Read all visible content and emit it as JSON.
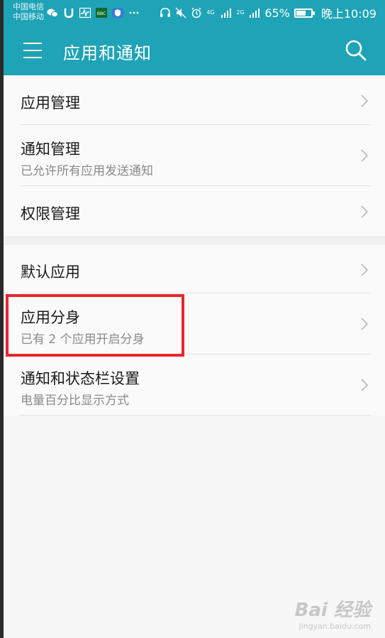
{
  "status_bar": {
    "carrier_1": "中国电信",
    "carrier_2": "中国移动",
    "network_1": "4G",
    "network_2": "2G",
    "battery_percent": "65%",
    "battery_level": 0.65,
    "time": "晚上10:09",
    "icons_left": [
      "wechat-icon",
      "shield-u-icon",
      "pulse-icon",
      "bbc-icon",
      "security-icon",
      "more-icon"
    ],
    "icons_right": [
      "headphone-icon",
      "mute-icon",
      "alarm-icon",
      "signal-icon",
      "battery-icon"
    ]
  },
  "app_bar": {
    "title": "应用和通知",
    "menu_icon": "menu-icon",
    "search_icon": "search-icon"
  },
  "groups": [
    {
      "items": [
        {
          "title": "应用管理",
          "subtitle": ""
        },
        {
          "title": "通知管理",
          "subtitle": "已允许所有应用发送通知"
        },
        {
          "title": "权限管理",
          "subtitle": ""
        }
      ]
    },
    {
      "items": [
        {
          "title": "默认应用",
          "subtitle": ""
        },
        {
          "title": "应用分身",
          "subtitle": "已有 2 个应用开启分身"
        },
        {
          "title": "通知和状态栏设置",
          "subtitle": "电量百分比显示方式"
        }
      ]
    }
  ],
  "colors": {
    "accent": "#1fa3b6",
    "highlight": "#e8262a"
  },
  "watermark": {
    "main": "Bai 经验",
    "sub": "jingyan.baidu.com"
  }
}
